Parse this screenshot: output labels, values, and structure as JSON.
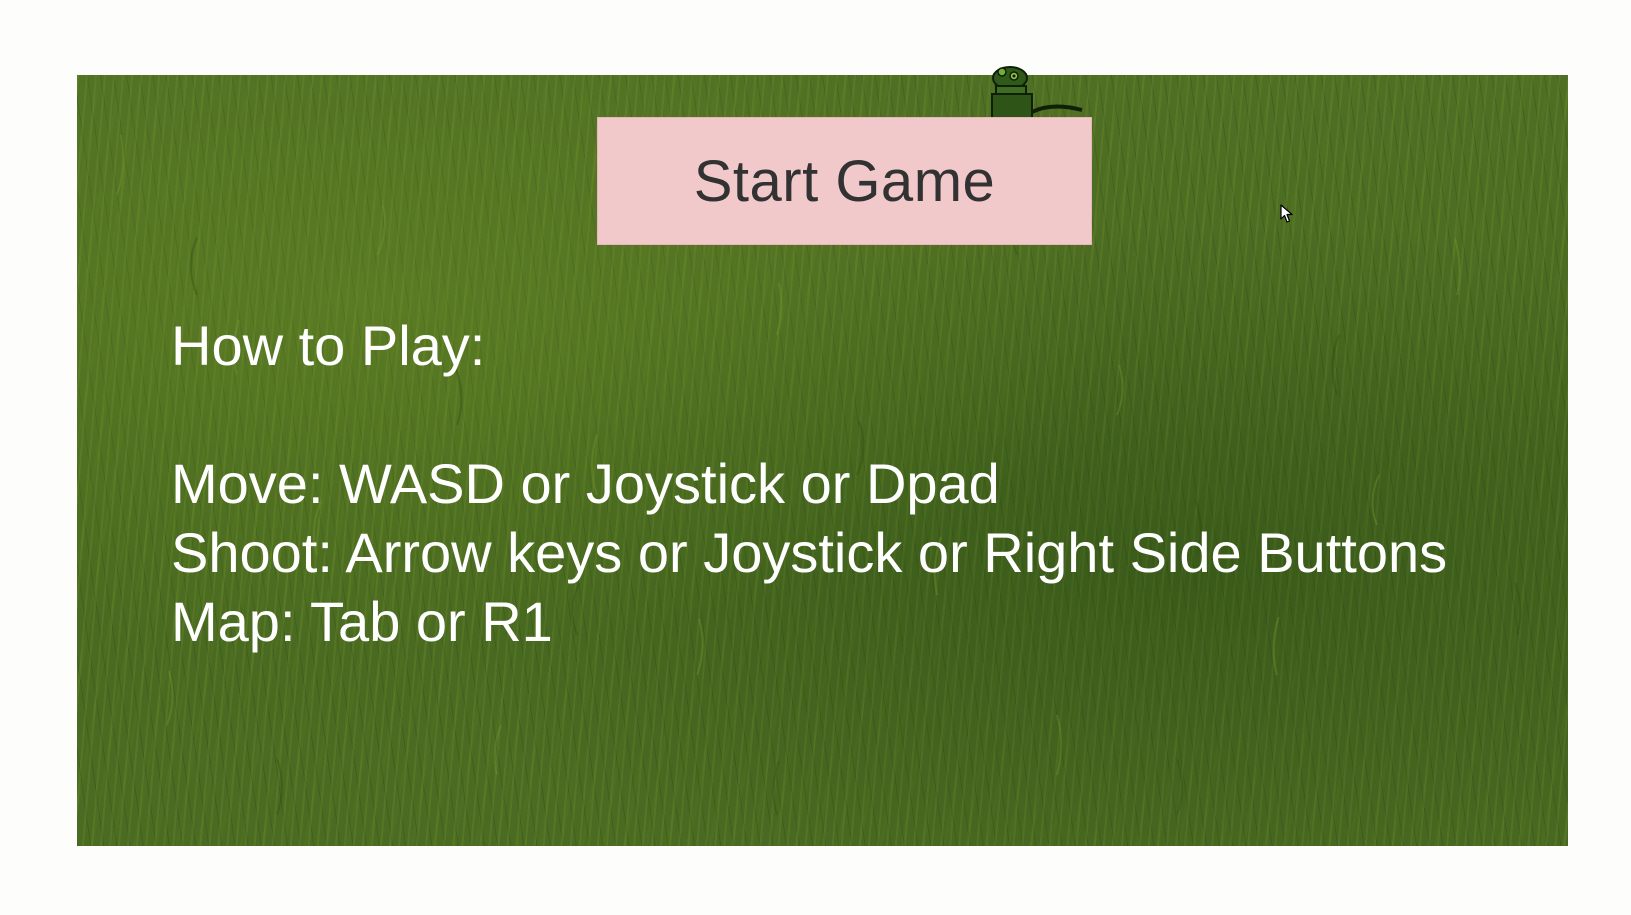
{
  "start_button": {
    "label": "Start Game"
  },
  "instructions": {
    "heading": "How to Play:",
    "lines": [
      "Move: WASD or Joystick or Dpad",
      "Shoot: Arrow keys or Joystick or Right Side Buttons",
      "Map: Tab or R1"
    ]
  },
  "icons": {
    "player": "player-sprite-icon",
    "cursor": "mouse-cursor-icon"
  },
  "colors": {
    "grass": "#4b6b22",
    "button_bg": "#f2c9ca",
    "button_text": "#323232",
    "instruction_text": "#ffffff",
    "page_bg": "#fdfdfb"
  }
}
